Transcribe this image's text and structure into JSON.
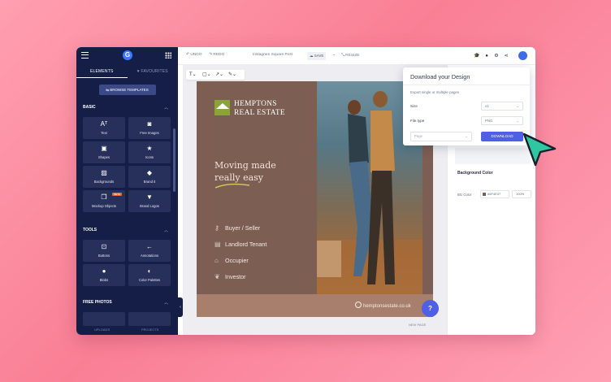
{
  "sidebar": {
    "tabs": [
      "ELEMENTS",
      "FAVOURITES"
    ],
    "browse_label": "BROWSE TEMPLATES",
    "basic_heading": "BASIC",
    "basic_items": [
      {
        "label": "Text",
        "icon": "text-icon"
      },
      {
        "label": "Free Images",
        "icon": "camera-icon"
      },
      {
        "label": "Shapes",
        "icon": "shapes-icon"
      },
      {
        "label": "Icons",
        "icon": "star-icon"
      },
      {
        "label": "Backgrounds",
        "icon": "pattern-icon"
      },
      {
        "label": "Brand it",
        "icon": "brand-icon"
      },
      {
        "label": "Mockup Objects",
        "icon": "cube-icon",
        "badge": "BETA"
      },
      {
        "label": "Brand Logos",
        "icon": "logo-icon"
      }
    ],
    "tools_heading": "TOOLS",
    "tools_items": [
      {
        "label": "Buttons",
        "icon": "button-icon"
      },
      {
        "label": "Annotations",
        "icon": "arrow-icon"
      },
      {
        "label": "Blobs",
        "icon": "blob-icon"
      },
      {
        "label": "Color Palettes",
        "icon": "palette-icon"
      }
    ],
    "photos_heading": "FREE PHOTOS",
    "bottom": [
      "UPLOADS",
      "PROJECTS"
    ]
  },
  "topbar": {
    "undo": "UNDO",
    "redo": "REDO",
    "doc_name": "Instagram Square Post",
    "save": "SAVE",
    "resize": "RESIZE"
  },
  "design": {
    "brand_line1": "HEMPTONS",
    "brand_line2": "REAL ESTATE",
    "headline1": "Moving made",
    "headline2": "really easy",
    "services": [
      {
        "label": "Buyer / Seller",
        "icon": "key-icon"
      },
      {
        "label": "Landlord Tenant",
        "icon": "document-icon"
      },
      {
        "label": "Occupier",
        "icon": "home-icon"
      },
      {
        "label": "Investor",
        "icon": "plant-icon"
      }
    ],
    "url": "hemptonsestate.co.uk"
  },
  "workspace": {
    "help": "?",
    "new_page": "NEW PAGE"
  },
  "right_panel": {
    "background_heading": "Background Color",
    "bg_label": "BG Color",
    "bg_hex": "#6F4E37",
    "bg_opacity": "100%"
  },
  "dialog": {
    "title": "Download your Design",
    "subtitle": "Export single or multiple pages",
    "size_label": "Size",
    "size_value": "x1",
    "filetype_label": "File type",
    "filetype_value": "PNG",
    "page_placeholder": "Page",
    "download_label": "DOWNLOAD"
  },
  "colors": {
    "sidebar": "#141e46",
    "accent": "#4f5fe6",
    "design_bg": "#7c5e52",
    "logo_green": "#8aa43a",
    "cursor": "#2ec7a0"
  }
}
